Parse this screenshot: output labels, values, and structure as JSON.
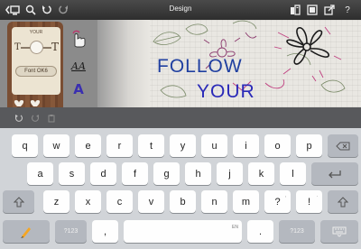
{
  "top_bar": {
    "title": "Design",
    "left_icons": [
      "back-screen-icon",
      "zoom-icon",
      "undo-icon",
      "redo-icon"
    ],
    "right_icons": [
      "clipboard-icon",
      "layers-icon",
      "share-icon",
      "help-icon"
    ],
    "help_label": "?"
  },
  "left_panel": {
    "card_label": "YOUR",
    "font_button_label": "Font OK6",
    "slider_value_percent": 45,
    "glyph_left": "T",
    "glyph_right": "T",
    "tools": [
      "touch-tool-icon",
      "text-style-icon",
      "font-color-icon"
    ],
    "style_letters": "AA",
    "color_letter": "A"
  },
  "canvas": {
    "line1": "FOLLOW",
    "line2": "YOUR",
    "colors": {
      "line1": "#1f3fa0",
      "line2": "#2a2ab8",
      "doodle": "#8c3a6e",
      "leaf": "#7a8a68"
    }
  },
  "keyboard_toolbar": {
    "icons": [
      "undo-icon",
      "redo-icon",
      "paste-icon"
    ]
  },
  "keyboard": {
    "row1": [
      "q",
      "w",
      "e",
      "r",
      "t",
      "y",
      "u",
      "i",
      "o",
      "p"
    ],
    "row2": [
      "a",
      "s",
      "d",
      "f",
      "g",
      "h",
      "j",
      "k",
      "l"
    ],
    "row3": [
      "z",
      "x",
      "c",
      "v",
      "b",
      "n",
      "m",
      "?",
      "!"
    ],
    "row3_punct_sub": [
      "",
      "",
      "",
      "",
      "",
      "",
      "",
      ",",
      "."
    ],
    "row4": {
      "numbers_left": "?123",
      "comma": ",",
      "space_hint": "EN",
      "period": ".",
      "numbers_right": "?123"
    },
    "special_icons": [
      "backspace-icon",
      "return-icon",
      "shift-icon",
      "shift-icon",
      "swipe-pen-icon",
      "keyboard-hide-icon"
    ]
  }
}
